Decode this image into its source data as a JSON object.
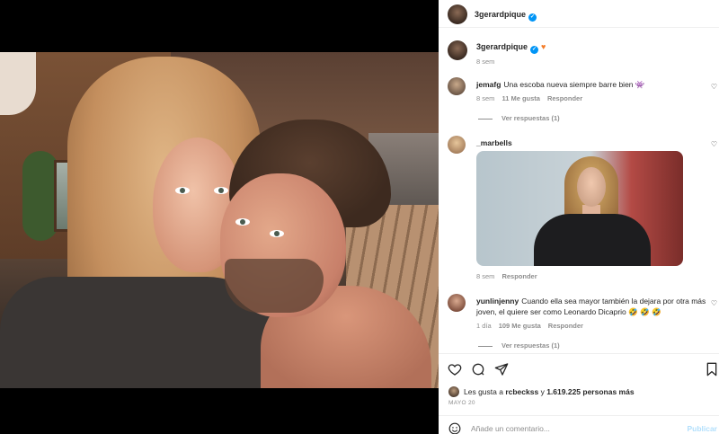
{
  "post": {
    "header": {
      "username": "3gerardpique",
      "verified": true
    },
    "caption": {
      "username": "3gerardpique",
      "time": "8 sem",
      "emoji": "orange-heart"
    },
    "comments": [
      {
        "username": "jemafg",
        "text": "Una escoba nueva siempre barre bien 👾",
        "time": "8 sem",
        "likes": "11 Me gusta",
        "reply": "Responder",
        "view_replies": "Ver respuestas (1)"
      },
      {
        "username": "_marbells",
        "text": "",
        "time": "8 sem",
        "reply": "Responder",
        "media": "gif"
      },
      {
        "username": "yunlinjenny",
        "text": "Cuando ella sea mayor también la dejara por otra más joven, el quiere ser como Leonardo Dicaprio 🤣 🤣 🤣",
        "time": "1 día",
        "likes": "109 Me gusta",
        "reply": "Responder",
        "view_replies": "Ver respuestas (1)"
      }
    ],
    "likes": {
      "prefix": "Les gusta a",
      "user": "rcbeckss",
      "connector": "y",
      "count": "1.619.225 personas más"
    },
    "date": "MAYO 20",
    "add_comment": {
      "placeholder": "Añade un comentario...",
      "post_label": "Publicar"
    }
  },
  "colors": {
    "accent": "#0095f6",
    "muted": "#8e8e8e",
    "text": "#262626"
  }
}
